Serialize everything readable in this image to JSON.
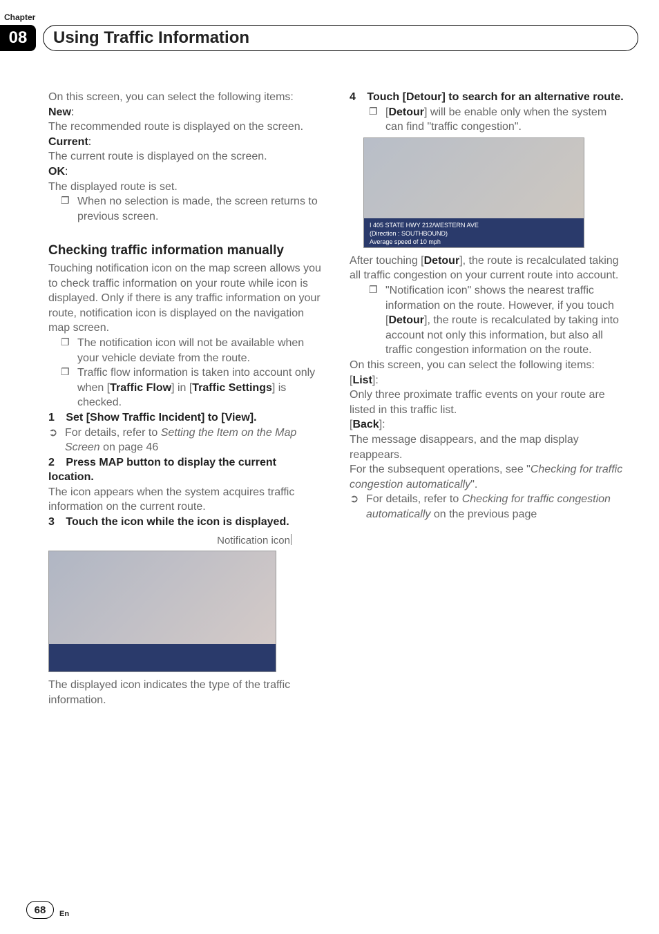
{
  "header": {
    "chapter_label": "Chapter",
    "chapter_number": "08",
    "title": "Using Traffic Information"
  },
  "left": {
    "intro": "On this screen, you can select the following items:",
    "new_label": "New",
    "new_desc": "The recommended route is displayed on the screen.",
    "current_label": "Current",
    "current_desc": "The current route is displayed on the screen.",
    "ok_label": "OK",
    "ok_desc": "The displayed route is set.",
    "ok_bullet": "When no selection is made, the screen returns to previous screen.",
    "section_heading": "Checking traffic information manually",
    "section_para": "Touching notification icon on the map screen allows you to check traffic information on your route while icon is displayed. Only if there is any traffic information on your route, notification icon is displayed on the navigation map screen.",
    "sec_b1": "The notification icon will not be available when your vehicle deviate from the route.",
    "sec_b2_pre": "Traffic flow information is taken into account only when [",
    "sec_b2_tf": "Traffic Flow",
    "sec_b2_mid": "] in [",
    "sec_b2_ts": "Traffic Settings",
    "sec_b2_post": "] is checked.",
    "step1_num": "1",
    "step1_text": "Set [Show Traffic Incident] to [View].",
    "step1_ref_pre": "For details, refer to ",
    "step1_ref_it": "Setting the Item on the Map Screen",
    "step1_ref_post": " on page 46",
    "step2_num": "2",
    "step2_text": "Press MAP button to display the current location.",
    "step2_desc": "The icon appears when the system acquires traffic information on the current route.",
    "step3_num": "3",
    "step3_text": "Touch the icon while the icon is displayed.",
    "caption": "Notification icon",
    "img_desc": "The displayed icon indicates the type of the traffic information."
  },
  "right": {
    "step4_num": "4",
    "step4_text": "Touch [Detour] to search for an alternative route.",
    "step4_b_pre": "[",
    "step4_b_bold": "Detour",
    "step4_b_post": "] will be enable only when the system can find \"traffic congestion\".",
    "img2_line1": "I 405 STATE HWY 212/WESTERN AVE",
    "img2_line2": "(Direction : SOUTHBOUND)",
    "img2_line3": "Average speed of 10 mph",
    "after_pre": "After touching [",
    "after_bold": "Detour",
    "after_post": "], the route is recalculated taking all traffic congestion on your current route into account.",
    "after_b_pre": "\"Notification icon\" shows the nearest traffic information on the route. However, if you touch [",
    "after_b_bold": "Detour",
    "after_b_post": "], the route is recalculated by taking into account not only this information, but also all traffic congestion information on the route.",
    "items_intro": "On this screen, you can select the following items:",
    "list_label": "List",
    "list_desc": "Only three proximate traffic events on your route are listed in this traffic list.",
    "back_label": "Back",
    "back_desc": "The message disappears, and the map display reappears.",
    "subseq_pre": "For the subsequent operations, see \"",
    "subseq_it": "Checking for traffic congestion automatically",
    "subseq_post": "\".",
    "ref_pre": "For details, refer to ",
    "ref_it": "Checking for traffic congestion automatically",
    "ref_post": " on the previous page"
  },
  "footer": {
    "page": "68",
    "lang": "En"
  }
}
